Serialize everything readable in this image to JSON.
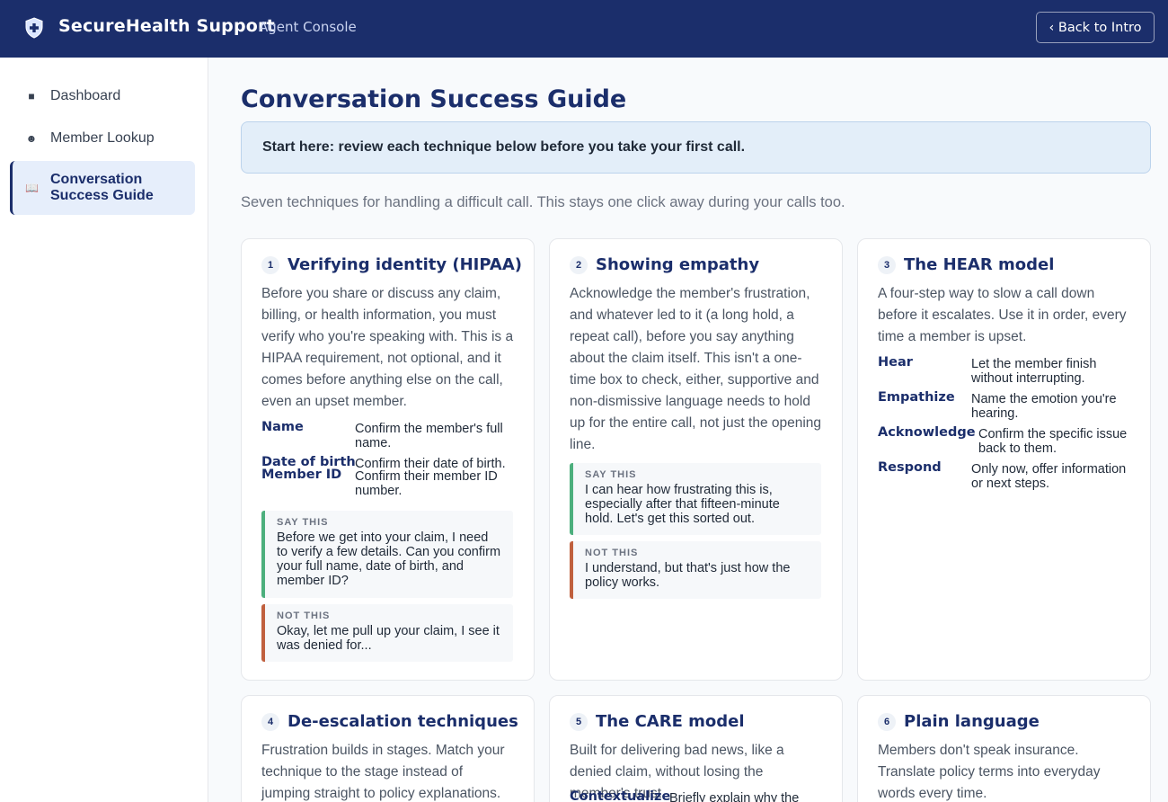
{
  "header": {
    "brand": "SecureHealth Support",
    "subtitle": "Agent Console",
    "back_button": "‹ Back to Intro"
  },
  "sidebar": {
    "items": [
      {
        "label": "Dashboard",
        "icon": "square-icon"
      },
      {
        "label": "Member Lookup",
        "icon": "search-circle-icon"
      },
      {
        "label": "Conversation Success Guide",
        "icon": "book-icon",
        "active": true
      }
    ]
  },
  "main": {
    "title": "Conversation Success Guide",
    "callout": "Start here: review each technique below before you take your first call.",
    "intro": "Seven techniques for handling a difficult call. This stays one click away during your calls too.",
    "cards": [
      {
        "number": "1",
        "title": "Verifying identity (HIPAA)",
        "body": "Before you share or discuss any claim, billing, or health information, you must verify who you're speaking with. This is a HIPAA requirement, not optional, and it comes before anything else on the call, even an upset member.",
        "terms": [
          {
            "term": "Name",
            "def": "Confirm the member's full name."
          },
          {
            "term": "Date of birth",
            "def": "Confirm their date of birth."
          },
          {
            "term": "Member ID",
            "def": "Confirm their member ID number."
          }
        ],
        "say_tag": "SAY THIS",
        "say": "Before we get into your claim, I need to verify a few details. Can you confirm your full name, date of birth, and member ID?",
        "not_tag": "NOT THIS",
        "not": "Okay, let me pull up your claim, I see it was denied for..."
      },
      {
        "number": "2",
        "title": "Showing empathy",
        "body": "Acknowledge the member's frustration, and whatever led to it (a long hold, a repeat call), before you say anything about the claim itself. This isn't a one-time box to check, either, supportive and non-dismissive language needs to hold up for the entire call, not just the opening line.",
        "say_tag": "SAY THIS",
        "say": "I can hear how frustrating this is, especially after that fifteen-minute hold. Let's get this sorted out.",
        "not_tag": "NOT THIS",
        "not": "I understand, but that's just how the policy works."
      },
      {
        "number": "3",
        "title": "The HEAR model",
        "body": "A four-step way to slow a call down before it escalates. Use it in order, every time a member is upset.",
        "terms": [
          {
            "term": "Hear",
            "def": "Let the member finish without interrupting."
          },
          {
            "term": "Empathize",
            "def": "Name the emotion you're hearing."
          },
          {
            "term": "Acknowledge",
            "def": "Confirm the specific issue back to them."
          },
          {
            "term": "Respond",
            "def": "Only now, offer information or next steps."
          }
        ]
      },
      {
        "number": "4",
        "title": "De-escalation techniques",
        "body": "Frustration builds in stages. Match your technique to the stage instead of jumping straight to policy explanations."
      },
      {
        "number": "5",
        "title": "The CARE model",
        "body": "Built for delivering bad news, like a denied claim, without losing the member's trust.",
        "terms": [
          {
            "term": "Contextualize",
            "def": "Briefly explain why the"
          }
        ]
      },
      {
        "number": "6",
        "title": "Plain language",
        "body": "Members don't speak insurance. Translate policy terms into everyday words every time."
      }
    ]
  },
  "colors": {
    "navy": "#1b2e6b",
    "say_accent": "#4caf7d",
    "not_accent": "#c0603e",
    "callout_bg": "#e3eef9"
  }
}
